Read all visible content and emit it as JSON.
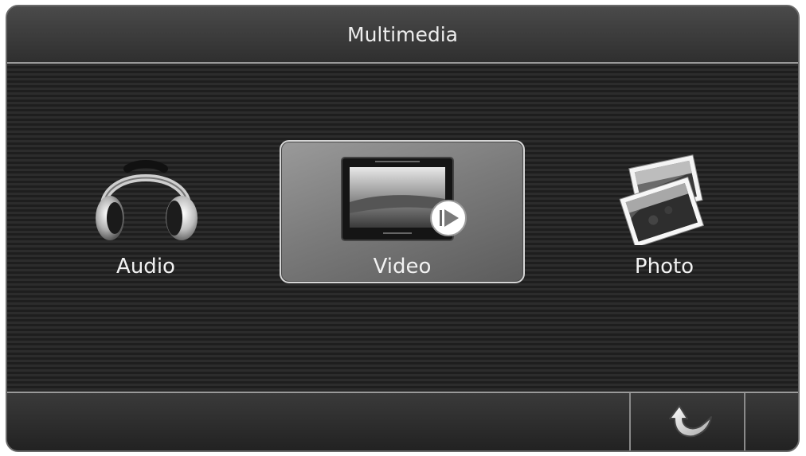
{
  "header": {
    "title": "Multimedia"
  },
  "menu": {
    "items": [
      {
        "label": "Audio",
        "icon": "headphones-icon",
        "selected": false
      },
      {
        "label": "Video",
        "icon": "video-player-icon",
        "selected": true
      },
      {
        "label": "Photo",
        "icon": "photos-icon",
        "selected": false
      }
    ]
  },
  "footer": {
    "back_icon": "back-arrow-icon"
  }
}
